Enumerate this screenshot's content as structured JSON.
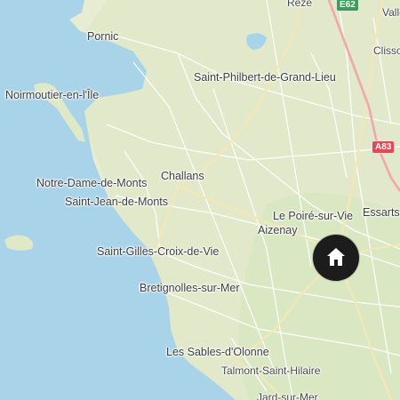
{
  "map": {
    "colors": {
      "sea": "#a9d3e9",
      "land": "#e8ecd2",
      "land_green": "#d9e8c5",
      "road_minor": "#ffffff",
      "road_major": "#f3e7b6",
      "motorway": "#f0a8a8",
      "marker": "#1c1c1c"
    },
    "places": {
      "reze": "Rezé",
      "pornic": "Pornic",
      "valle": "Valle",
      "clisson": "Clisso",
      "saint_philbert": "Saint-Philbert-de-Grand-Lieu",
      "noirmoutier": "Noirmoutier-en-l'Île",
      "challans": "Challans",
      "notre_dame": "Notre-Dame-de-Monts",
      "saint_jean": "Saint-Jean-de-Monts",
      "le_poire": "Le Poiré-sur-Vie",
      "essarts": "Essarts-",
      "aizenay": "Aizenay",
      "saint_gilles": "Saint-Gilles-Croix-de-Vie",
      "bretignolles": "Bretignolles-sur-Mer",
      "les_sables": "Les Sables-d'Olonne",
      "talmont": "Talmont-Saint-Hilaire",
      "jard": "Jard-sur-Mer"
    },
    "shields": {
      "e62": "E62",
      "a83": "A83"
    },
    "marker": {
      "icon": "home-icon"
    }
  }
}
